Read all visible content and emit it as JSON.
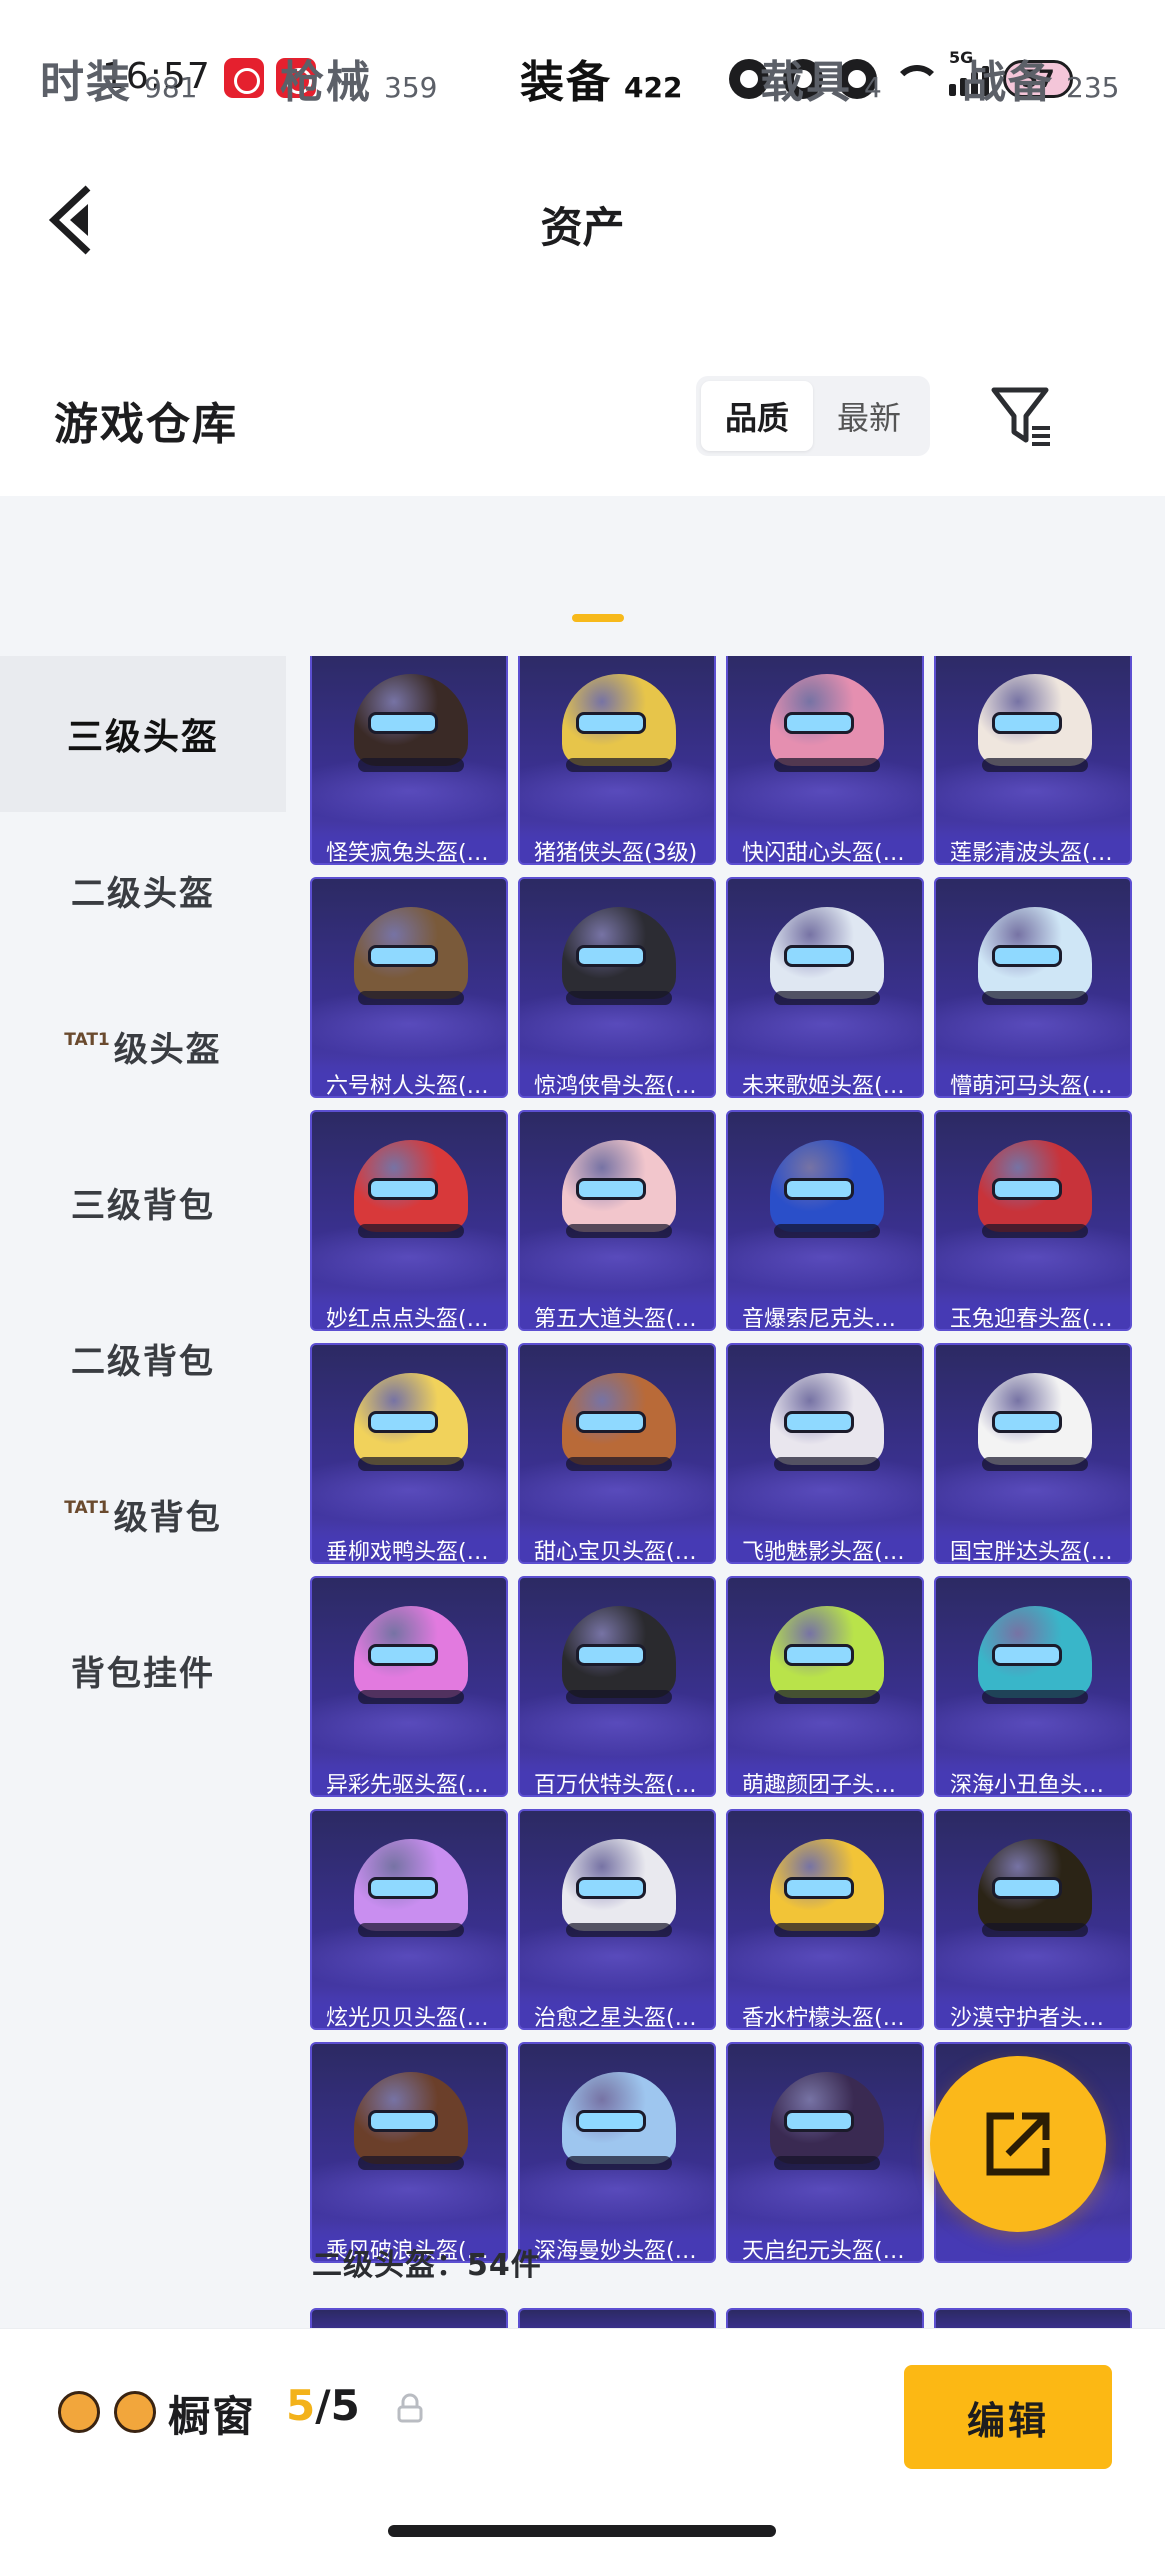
{
  "status_bar": {
    "time": "16:57",
    "network_tag": "5G",
    "battery": "57"
  },
  "header": {
    "title": "资产"
  },
  "warehouse": {
    "title": "游戏仓库",
    "sort_options": [
      "品质",
      "最新"
    ],
    "active_sort": "品质"
  },
  "tabs": [
    {
      "label": "时装",
      "count": "981"
    },
    {
      "label": "枪械",
      "count": "359"
    },
    {
      "label": "装备",
      "count": "422"
    },
    {
      "label": "载具",
      "count": "4"
    },
    {
      "label": "战备",
      "count": "235"
    }
  ],
  "active_tab": "装备",
  "sidebar": {
    "items": [
      {
        "label": "三级头盔",
        "tier": ""
      },
      {
        "label": "二级头盔",
        "tier": ""
      },
      {
        "label": "级头盔",
        "tier": "TAT1"
      },
      {
        "label": "三级背包",
        "tier": ""
      },
      {
        "label": "二级背包",
        "tier": ""
      },
      {
        "label": "级背包",
        "tier": "TAT1"
      },
      {
        "label": "背包挂件",
        "tier": ""
      }
    ],
    "active_index": 0
  },
  "items": [
    {
      "name": "怪笑疯兔头盔(…",
      "color": "#3a2a26"
    },
    {
      "name": "猪猪侠头盔(3级)",
      "color": "#e7c54a"
    },
    {
      "name": "快闪甜心头盔(…",
      "color": "#e58fb0"
    },
    {
      "name": "莲影清波头盔(…",
      "color": "#efe6de"
    },
    {
      "name": "六号树人头盔(…",
      "color": "#7a5a3a"
    },
    {
      "name": "惊鸿侠骨头盔(…",
      "color": "#2c2c33"
    },
    {
      "name": "未来歌姬头盔(…",
      "color": "#dfe7f2"
    },
    {
      "name": "懵萌河马头盔(…",
      "color": "#cfe6f6"
    },
    {
      "name": "妙红点点头盔(…",
      "color": "#d8393a"
    },
    {
      "name": "第五大道头盔(…",
      "color": "#f2c6cc"
    },
    {
      "name": "音爆索尼克头…",
      "color": "#2a4fc9"
    },
    {
      "name": "玉兔迎春头盔(…",
      "color": "#c8333a"
    },
    {
      "name": "垂柳戏鸭头盔(…",
      "color": "#f1d25b"
    },
    {
      "name": "甜心宝贝头盔(…",
      "color": "#b96a38"
    },
    {
      "name": "飞驰魅影头盔(…",
      "color": "#e9e6ee"
    },
    {
      "name": "国宝胖达头盔(…",
      "color": "#f3f3f3"
    },
    {
      "name": "异彩先驱头盔(…",
      "color": "#e27adf"
    },
    {
      "name": "百万伏特头盔(…",
      "color": "#2a2a2e"
    },
    {
      "name": "萌趣颜团子头…",
      "color": "#b9e34a"
    },
    {
      "name": "深海小丑鱼头…",
      "color": "#39b6c9"
    },
    {
      "name": "炫光贝贝头盔(…",
      "color": "#c98ef0"
    },
    {
      "name": "治愈之星头盔(…",
      "color": "#e9e9ef"
    },
    {
      "name": "香水柠檬头盔(…",
      "color": "#f2c437"
    },
    {
      "name": "沙漠守护者头…",
      "color": "#2b2416"
    },
    {
      "name": "乘风破浪头盔(…",
      "color": "#6b3f2a"
    },
    {
      "name": "深海曼妙头盔(…",
      "color": "#9ec6ef"
    },
    {
      "name": "天启纪元头盔(…",
      "color": "#3a2a52"
    },
    {
      "name": "",
      "color": "#e04fb3"
    }
  ],
  "next_section": {
    "caption": "二级头盔：54件"
  },
  "bottom_bar": {
    "label": "橱窗",
    "current": "5",
    "total": "/5",
    "edit_label": "编辑"
  },
  "colors": {
    "accent": "#fcb814",
    "card_bg": "#3b3192"
  }
}
